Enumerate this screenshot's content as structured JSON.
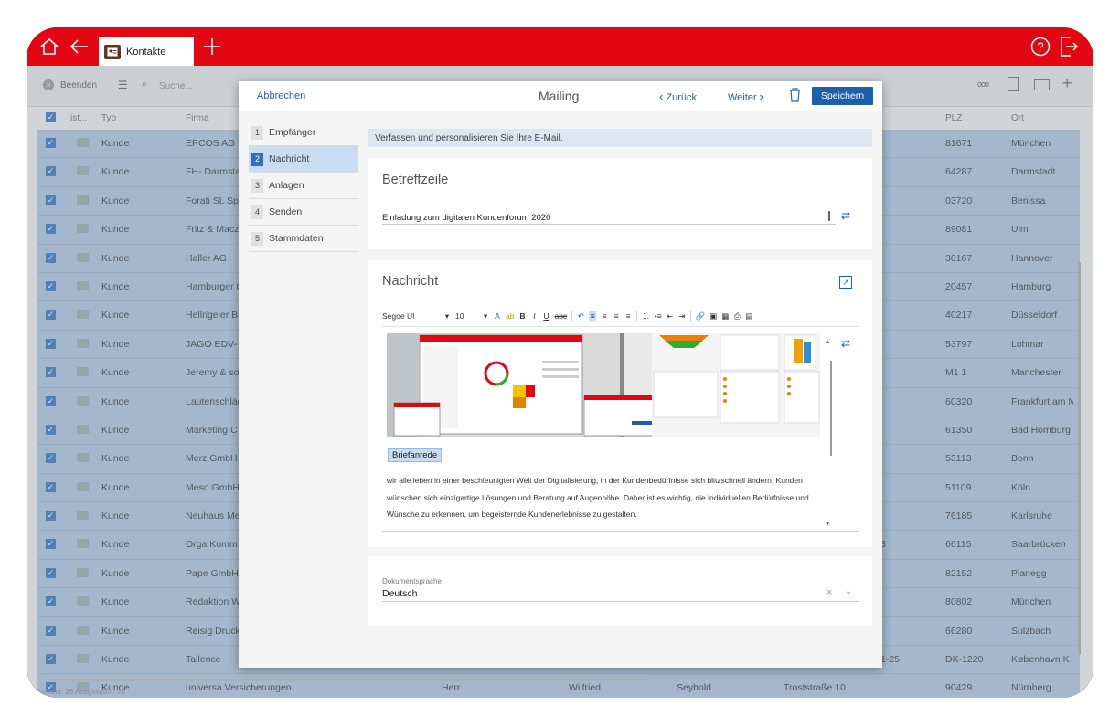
{
  "app": {
    "tab_title": "Kontakte",
    "accent": "#e30613"
  },
  "toolbar": {
    "beenden": "Beenden",
    "search_placeholder": "Suche...",
    "more_label": "ooo"
  },
  "grid": {
    "headers": {
      "ist": "ist...",
      "typ": "Typ",
      "firma": "Firma",
      "plz": "PLZ",
      "ort": "Ort"
    },
    "rows": [
      {
        "typ": "Kunde",
        "firma": "EPCOS AG",
        "plz": "81671",
        "ort": "München",
        "extra": ""
      },
      {
        "typ": "Kunde",
        "firma": "FH- Darmsta",
        "plz": "64287",
        "ort": "Darmstadt",
        "extra": ""
      },
      {
        "typ": "Kunde",
        "firma": "Forati SL Sp",
        "plz": "03720",
        "ort": "Benissa",
        "extra": ""
      },
      {
        "typ": "Kunde",
        "firma": "Fritz & Macz",
        "plz": "89081",
        "ort": "Ulm",
        "extra": ""
      },
      {
        "typ": "Kunde",
        "firma": "Haller AG",
        "plz": "30167",
        "ort": "Hannover",
        "extra": ""
      },
      {
        "typ": "Kunde",
        "firma": "Hamburger C",
        "plz": "20457",
        "ort": "Hamburg",
        "extra": ""
      },
      {
        "typ": "Kunde",
        "firma": "Hellrigeler B",
        "plz": "40217",
        "ort": "Düsseldorf",
        "extra": ""
      },
      {
        "typ": "Kunde",
        "firma": "JAGO EDV- S",
        "plz": "53797",
        "ort": "Lohmar",
        "extra": ""
      },
      {
        "typ": "Kunde",
        "firma": "Jeremy & so",
        "plz": "M1 1",
        "ort": "Manchester",
        "extra": ""
      },
      {
        "typ": "Kunde",
        "firma": "Lautenschläg",
        "plz": "60320",
        "ort": "Frankfurt am M",
        "extra": ""
      },
      {
        "typ": "Kunde",
        "firma": "Marketing C",
        "plz": "61350",
        "ort": "Bad Homburg",
        "extra": ""
      },
      {
        "typ": "Kunde",
        "firma": "Merz GmbH",
        "plz": "53113",
        "ort": "Bonn",
        "extra": ""
      },
      {
        "typ": "Kunde",
        "firma": "Meso GmbH",
        "plz": "51109",
        "ort": "Köln",
        "extra": ""
      },
      {
        "typ": "Kunde",
        "firma": "Neuhaus Me",
        "plz": "76185",
        "ort": "Karlsruhe",
        "extra": ""
      },
      {
        "typ": "Kunde",
        "firma": "Orga Komm",
        "plz": "66115",
        "ort": "Saarbrücken",
        "extra": "3"
      },
      {
        "typ": "Kunde",
        "firma": "Pape GmbH",
        "plz": "82152",
        "ort": "Planegg",
        "extra": ""
      },
      {
        "typ": "Kunde",
        "firma": "Redaktion W",
        "plz": "80802",
        "ort": "München",
        "extra": ""
      },
      {
        "typ": "Kunde",
        "firma": "Reisig Druck",
        "plz": "66280",
        "ort": "Sulzbach",
        "extra": ""
      },
      {
        "typ": "Kunde",
        "firma": "Tallence",
        "plz": "DK-1220",
        "ort": "København K",
        "extra": "1-25"
      },
      {
        "typ": "Kunde",
        "firma": "universa Versicherungen",
        "plz": "90429",
        "ort": "Nürnberg",
        "extra": "Troststraße 10",
        "c1": "Herr",
        "c2": "Wilfried",
        "c3": "Seybold"
      }
    ],
    "status": "Gesamt: 26 Ausgewählt: 26"
  },
  "dialog": {
    "cancel": "Abbrechen",
    "title": "Mailing",
    "back": "Zurück",
    "next": "Weiter",
    "save": "Speichern",
    "steps": [
      {
        "num": "1",
        "label": "Empfänger"
      },
      {
        "num": "2",
        "label": "Nachricht"
      },
      {
        "num": "3",
        "label": "Anlagen"
      },
      {
        "num": "4",
        "label": "Senden"
      },
      {
        "num": "5",
        "label": "Stammdaten"
      }
    ],
    "info": "Verfassen und personalisieren Sie Ihre E-Mail.",
    "subject_title": "Betreffzeile",
    "subject_value": "Einladung zum digitalen Kundenforum 2020",
    "message_title": "Nachricht",
    "font": "Segoe UI",
    "size": "10",
    "placeholder_tag": "Briefanrede",
    "body_lines": [
      "wir alle leben in einer beschleunigten Welt der Digitalisierung, in der Kundenbedürfnisse sich blitzschnell ändern. Kunden",
      "wünschen sich einzigartige Lösungen und Beratung auf Augenhöhe. Daher ist es wichtig, die individuellen Bedürfnisse und",
      "Wünsche zu erkennen, um begeisternde Kundenerlebnisse zu gestalten."
    ],
    "doc_lang_label": "Dokumentsprache",
    "doc_lang_value": "Deutsch"
  }
}
